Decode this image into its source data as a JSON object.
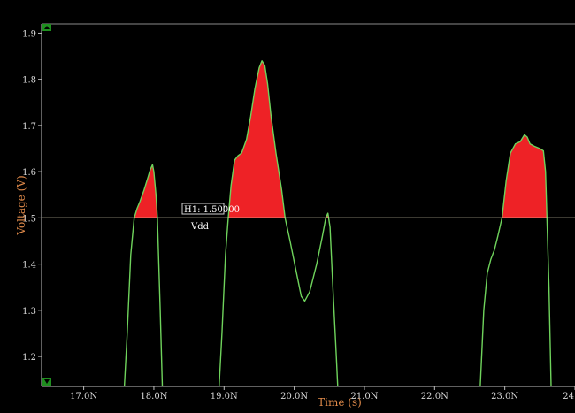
{
  "chart_data": {
    "type": "area",
    "xlabel": "Time (s)",
    "ylabel": "Voltage (V)",
    "xlim": [
      16.4,
      24.0
    ],
    "ylim": [
      1.135,
      1.92
    ],
    "x_ticks": [
      {
        "v": 17.0,
        "label": "17.0N"
      },
      {
        "v": 18.0,
        "label": "18.0N"
      },
      {
        "v": 19.0,
        "label": "19.0N"
      },
      {
        "v": 20.0,
        "label": "20.0N"
      },
      {
        "v": 21.0,
        "label": "21.0N"
      },
      {
        "v": 22.0,
        "label": "22.0N"
      },
      {
        "v": 23.0,
        "label": "23.0N"
      },
      {
        "v": 24.0,
        "label": "24"
      }
    ],
    "y_ticks": [
      {
        "v": 1.2,
        "label": "1.2"
      },
      {
        "v": 1.3,
        "label": "1.3"
      },
      {
        "v": 1.4,
        "label": "1.4"
      },
      {
        "v": 1.5,
        "label": "1.5"
      },
      {
        "v": 1.6,
        "label": "1.6"
      },
      {
        "v": 1.7,
        "label": "1.7"
      },
      {
        "v": 1.8,
        "label": "1.8"
      },
      {
        "v": 1.9,
        "label": "1.9"
      }
    ],
    "threshold": {
      "value": 1.5,
      "label": "H1: 1.50000"
    },
    "series": [
      {
        "name": "Vdd",
        "points": [
          [
            17.58,
            1.135
          ],
          [
            17.62,
            1.25
          ],
          [
            17.67,
            1.42
          ],
          [
            17.72,
            1.5
          ],
          [
            17.76,
            1.52
          ],
          [
            17.8,
            1.535
          ],
          [
            17.86,
            1.56
          ],
          [
            17.92,
            1.59
          ],
          [
            17.95,
            1.605
          ],
          [
            17.98,
            1.615
          ],
          [
            18.0,
            1.6
          ],
          [
            18.03,
            1.55
          ],
          [
            18.05,
            1.5
          ],
          [
            18.09,
            1.3
          ],
          [
            18.12,
            1.135
          ],
          [
            18.93,
            1.135
          ],
          [
            18.97,
            1.25
          ],
          [
            19.02,
            1.42
          ],
          [
            19.06,
            1.5
          ],
          [
            19.1,
            1.57
          ],
          [
            19.15,
            1.625
          ],
          [
            19.2,
            1.635
          ],
          [
            19.25,
            1.64
          ],
          [
            19.32,
            1.67
          ],
          [
            19.38,
            1.72
          ],
          [
            19.44,
            1.78
          ],
          [
            19.5,
            1.825
          ],
          [
            19.54,
            1.84
          ],
          [
            19.58,
            1.83
          ],
          [
            19.62,
            1.79
          ],
          [
            19.67,
            1.72
          ],
          [
            19.74,
            1.64
          ],
          [
            19.82,
            1.56
          ],
          [
            19.87,
            1.5
          ],
          [
            19.94,
            1.45
          ],
          [
            20.02,
            1.39
          ],
          [
            20.1,
            1.33
          ],
          [
            20.15,
            1.32
          ],
          [
            20.22,
            1.34
          ],
          [
            20.32,
            1.4
          ],
          [
            20.4,
            1.46
          ],
          [
            20.45,
            1.5
          ],
          [
            20.48,
            1.51
          ],
          [
            20.51,
            1.48
          ],
          [
            20.55,
            1.35
          ],
          [
            20.6,
            1.2
          ],
          [
            20.62,
            1.135
          ],
          [
            22.65,
            1.135
          ],
          [
            22.7,
            1.3
          ],
          [
            22.75,
            1.38
          ],
          [
            22.8,
            1.41
          ],
          [
            22.85,
            1.43
          ],
          [
            22.9,
            1.46
          ],
          [
            22.96,
            1.5
          ],
          [
            23.02,
            1.58
          ],
          [
            23.08,
            1.64
          ],
          [
            23.15,
            1.66
          ],
          [
            23.22,
            1.665
          ],
          [
            23.28,
            1.68
          ],
          [
            23.32,
            1.675
          ],
          [
            23.36,
            1.66
          ],
          [
            23.42,
            1.655
          ],
          [
            23.5,
            1.65
          ],
          [
            23.55,
            1.645
          ],
          [
            23.58,
            1.6
          ],
          [
            23.6,
            1.5
          ],
          [
            23.63,
            1.35
          ],
          [
            23.66,
            1.135
          ]
        ]
      }
    ]
  }
}
